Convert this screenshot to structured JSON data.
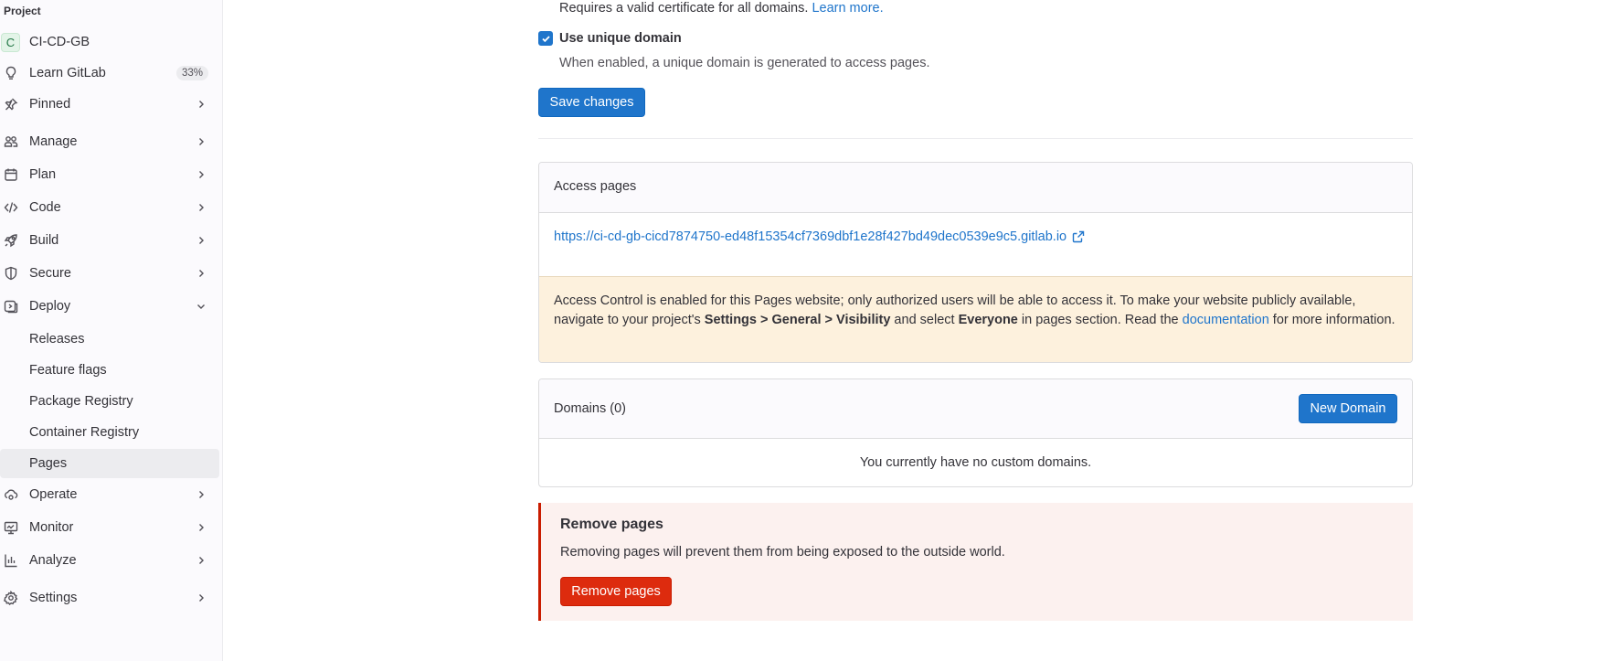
{
  "sidebar": {
    "section_label": "Project",
    "project": {
      "avatar_letter": "C",
      "name": "CI-CD-GB"
    },
    "learn": {
      "label": "Learn GitLab",
      "progress_badge": "33%"
    },
    "pinned": {
      "label": "Pinned"
    },
    "items": [
      {
        "label": "Manage",
        "icon": "users-icon"
      },
      {
        "label": "Plan",
        "icon": "calendar-icon"
      },
      {
        "label": "Code",
        "icon": "code-icon"
      },
      {
        "label": "Build",
        "icon": "rocket-icon"
      },
      {
        "label": "Secure",
        "icon": "shield-icon"
      },
      {
        "label": "Deploy",
        "icon": "deploy-icon",
        "expanded": true
      }
    ],
    "deploy_sub": [
      "Releases",
      "Feature flags",
      "Package Registry",
      "Container Registry",
      "Pages"
    ],
    "active_sub": "Pages",
    "items_after": [
      {
        "label": "Operate",
        "icon": "cloud-gear-icon"
      },
      {
        "label": "Monitor",
        "icon": "monitor-icon"
      },
      {
        "label": "Analyze",
        "icon": "chart-icon"
      },
      {
        "label": "Settings",
        "icon": "gear-icon"
      }
    ]
  },
  "main": {
    "https_text": "Requires a valid certificate for all domains.",
    "learn_more": "Learn more.",
    "unique_domain": {
      "checked": true,
      "label": "Use unique domain",
      "help": "When enabled, a unique domain is generated to access pages."
    },
    "save_button": "Save changes",
    "access_pages": {
      "title": "Access pages",
      "url": "https://ci-cd-gb-cicd7874750-ed48f15354cf7369dbf1e28f427bd49dec0539e9c5.gitlab.io",
      "warning_part1": "Access Control is enabled for this Pages website; only authorized users will be able to access it. To make your website publicly available, navigate to your project's ",
      "warning_bold1": "Settings > General > Visibility",
      "warning_part2": " and select ",
      "warning_bold2": "Everyone",
      "warning_part3": " in pages section. Read the ",
      "warning_link": "documentation",
      "warning_part4": " for more information."
    },
    "domains": {
      "title": "Domains (0)",
      "new_button": "New Domain",
      "empty": "You currently have no custom domains."
    },
    "remove": {
      "title": "Remove pages",
      "description": "Removing pages will prevent them from being exposed to the outside world.",
      "button": "Remove pages"
    }
  },
  "colors": {
    "primary": "#1f75cb",
    "danger": "#dd2b0e",
    "warning_bg": "#fdf1dd",
    "danger_bg": "#fcf1ef"
  }
}
